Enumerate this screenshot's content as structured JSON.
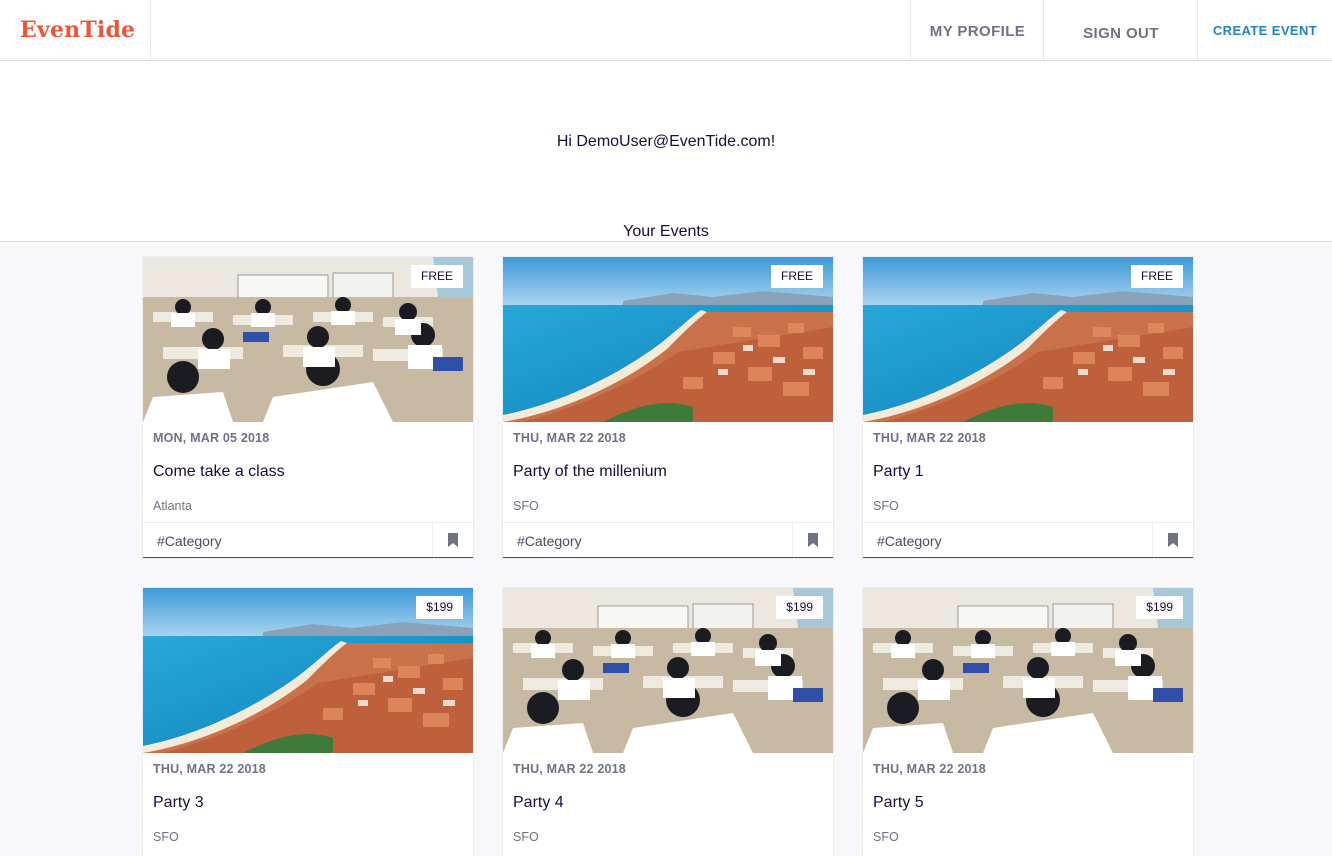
{
  "header": {
    "logo": "EvenTide",
    "nav": {
      "my_profile": "MY PROFILE",
      "sign_out": "SIGN OUT",
      "create_event": "CREATE EVENT"
    }
  },
  "greeting": "Hi DemoUser@EvenTide.com!",
  "section_title": "Your Events",
  "colors": {
    "brand": "#f05537",
    "link": "#1f86c6",
    "text": "#1e0a3c",
    "muted": "#6f7287"
  },
  "events": [
    {
      "image": "classroom-photo",
      "price": "FREE",
      "date": "MON, MAR 05 2018",
      "title": "Come take a class",
      "location": "Atlanta",
      "category": "#Category"
    },
    {
      "image": "coastline-photo",
      "price": "FREE",
      "date": "THU, MAR 22 2018",
      "title": "Party of the millenium",
      "location": "SFO",
      "category": "#Category"
    },
    {
      "image": "coastline-photo",
      "price": "FREE",
      "date": "THU, MAR 22 2018",
      "title": "Party 1",
      "location": "SFO",
      "category": "#Category"
    },
    {
      "image": "coastline-photo",
      "price": "$199",
      "date": "THU, MAR 22 2018",
      "title": "Party 3",
      "location": "SFO",
      "category": ""
    },
    {
      "image": "classroom-photo",
      "price": "$199",
      "date": "THU, MAR 22 2018",
      "title": "Party 4",
      "location": "SFO",
      "category": ""
    },
    {
      "image": "classroom-photo",
      "price": "$199",
      "date": "THU, MAR 22 2018",
      "title": "Party 5",
      "location": "SFO",
      "category": ""
    }
  ]
}
